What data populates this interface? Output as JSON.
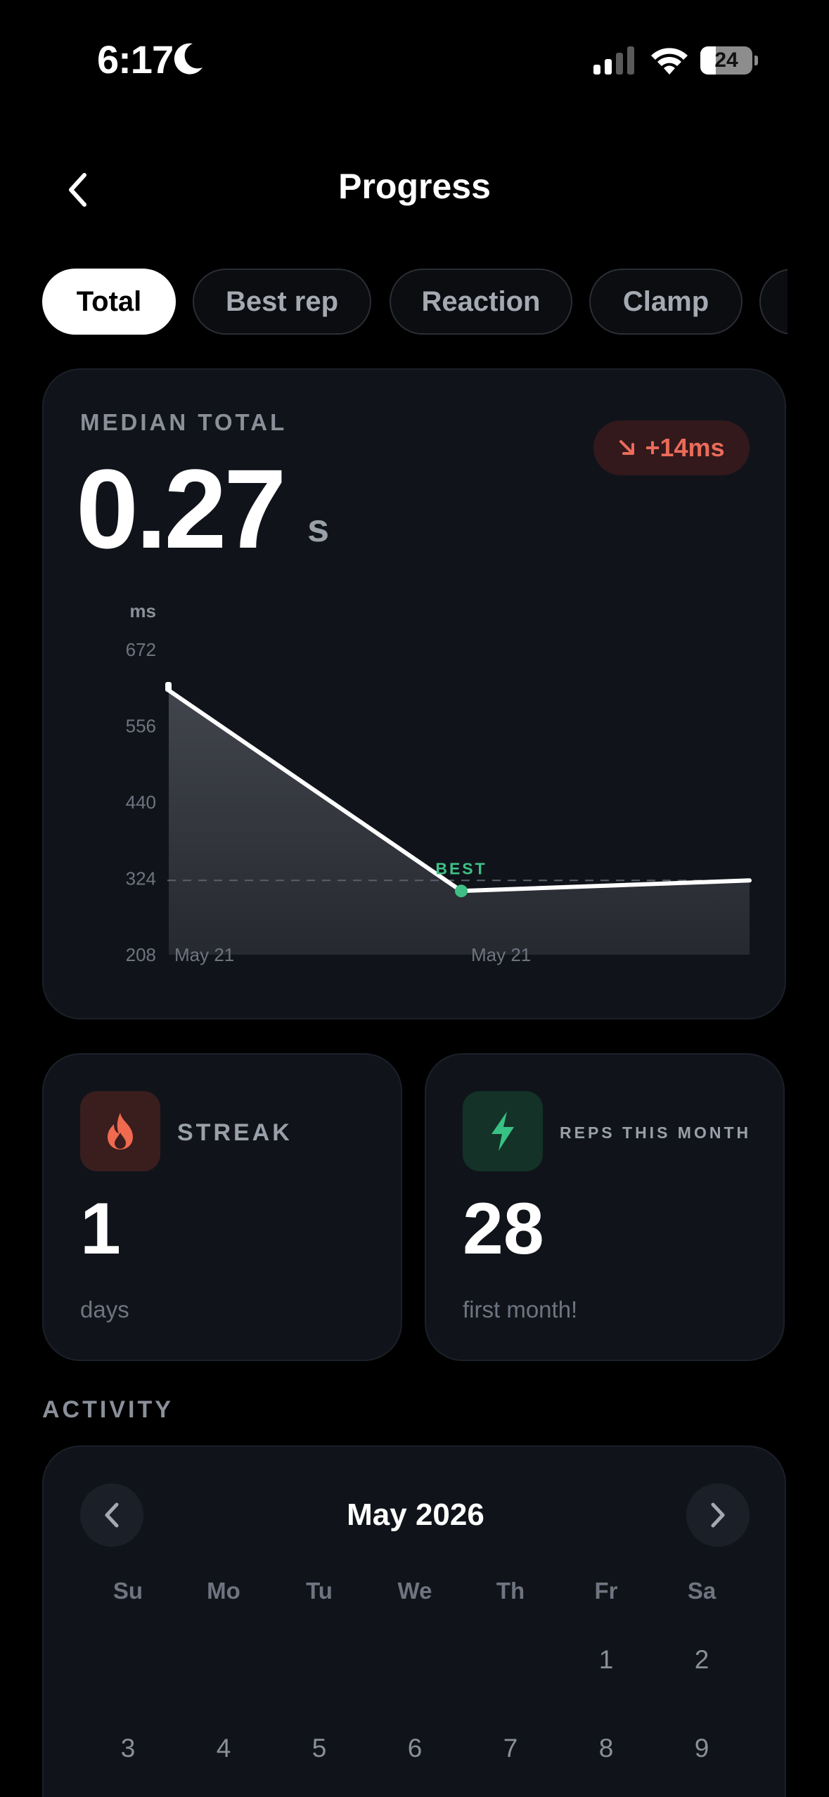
{
  "status_bar": {
    "time": "6:17",
    "battery": "24"
  },
  "header": {
    "title": "Progress"
  },
  "tabs": [
    {
      "label": "Total",
      "active": true
    },
    {
      "label": "Best rep",
      "active": false
    },
    {
      "label": "Reaction",
      "active": false
    },
    {
      "label": "Clamp",
      "active": false
    }
  ],
  "median": {
    "label": "MEDIAN TOTAL",
    "value": "0.27",
    "unit": "s",
    "delta": "+14ms",
    "delta_color": "#ea6b5a"
  },
  "chart_data": {
    "type": "area",
    "ylabel": "ms",
    "ylim": [
      208,
      672
    ],
    "yticks": [
      672,
      556,
      440,
      324,
      208
    ],
    "x_labels": [
      "May 21",
      "May 21"
    ],
    "series": [
      {
        "values": [
          610,
          305,
          321
        ]
      }
    ],
    "reference_line": 321,
    "best_label": "BEST",
    "best_index": 1,
    "best_color": "#3fbf86",
    "grid": false
  },
  "stats": {
    "streak": {
      "title": "STREAK",
      "value": "1",
      "sub": "days",
      "icon": "flame-icon",
      "accent": "#f06a50"
    },
    "reps": {
      "title": "REPS THIS MONTH",
      "value": "28",
      "sub": "first month!",
      "icon": "bolt-icon",
      "accent": "#38c184"
    }
  },
  "activity": {
    "title": "ACTIVITY",
    "month": "May 2026",
    "weekdays": [
      "Su",
      "Mo",
      "Tu",
      "We",
      "Th",
      "Fr",
      "Sa"
    ],
    "weeks": [
      [
        "",
        "",
        "",
        "",
        "",
        "1",
        "2"
      ],
      [
        "3",
        "4",
        "5",
        "6",
        "7",
        "8",
        "9"
      ]
    ]
  }
}
